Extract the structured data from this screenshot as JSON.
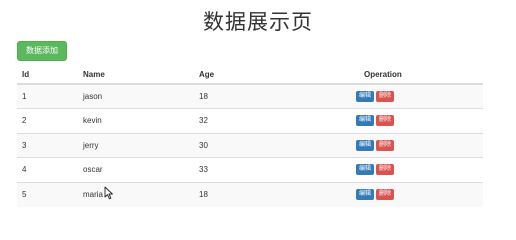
{
  "page": {
    "title": "数据展示页",
    "add_button_label": "数据添加"
  },
  "table": {
    "headers": [
      "Id",
      "Name",
      "Age",
      "Operation"
    ],
    "rows": [
      {
        "id": "1",
        "name": "jason",
        "age": "18"
      },
      {
        "id": "2",
        "name": "kevin",
        "age": "32"
      },
      {
        "id": "3",
        "name": "jerry",
        "age": "30"
      },
      {
        "id": "4",
        "name": "oscar",
        "age": "33"
      },
      {
        "id": "5",
        "name": "maria",
        "age": "18"
      }
    ],
    "edit_label": "编辑",
    "delete_label": "删除"
  },
  "colors": {
    "add_button": "#5cb85c",
    "edit_button": "#337ab7",
    "delete_button": "#d9534f"
  }
}
